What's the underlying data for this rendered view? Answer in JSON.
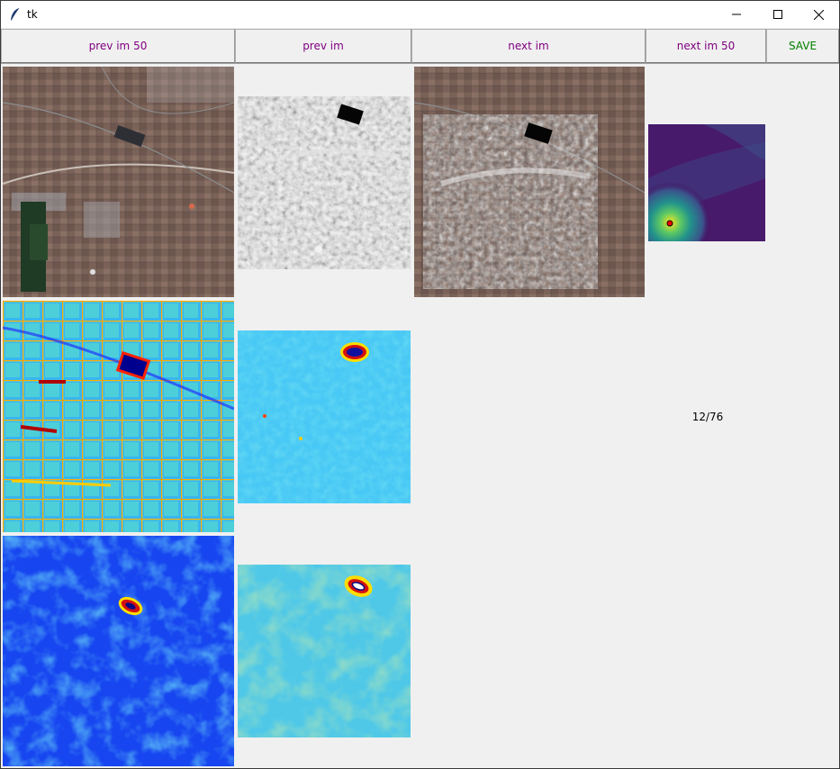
{
  "window": {
    "title": "tk",
    "controls": {
      "minimize": "minimize-icon",
      "maximize": "maximize-icon",
      "close": "close-icon"
    }
  },
  "toolbar": {
    "prev_50_label": "prev im 50",
    "prev_label": "prev im",
    "next_label": "next im",
    "next_50_label": "next im 50",
    "save_label": "SAVE",
    "label_color": "#800080",
    "save_color": "#008000"
  },
  "counter": {
    "text": "12/76"
  },
  "images": {
    "optical": "satellite-optical-image",
    "sar": "sar-grayscale-image",
    "overlay": "sar-overlay-on-optical-image",
    "heatmap": "correlation-heatmap-image",
    "grad_optical": "optical-gradient-map",
    "grad_sar": "sar-gradient-map",
    "feat_optical": "optical-feature-map",
    "feat_sar": "sar-feature-map"
  }
}
